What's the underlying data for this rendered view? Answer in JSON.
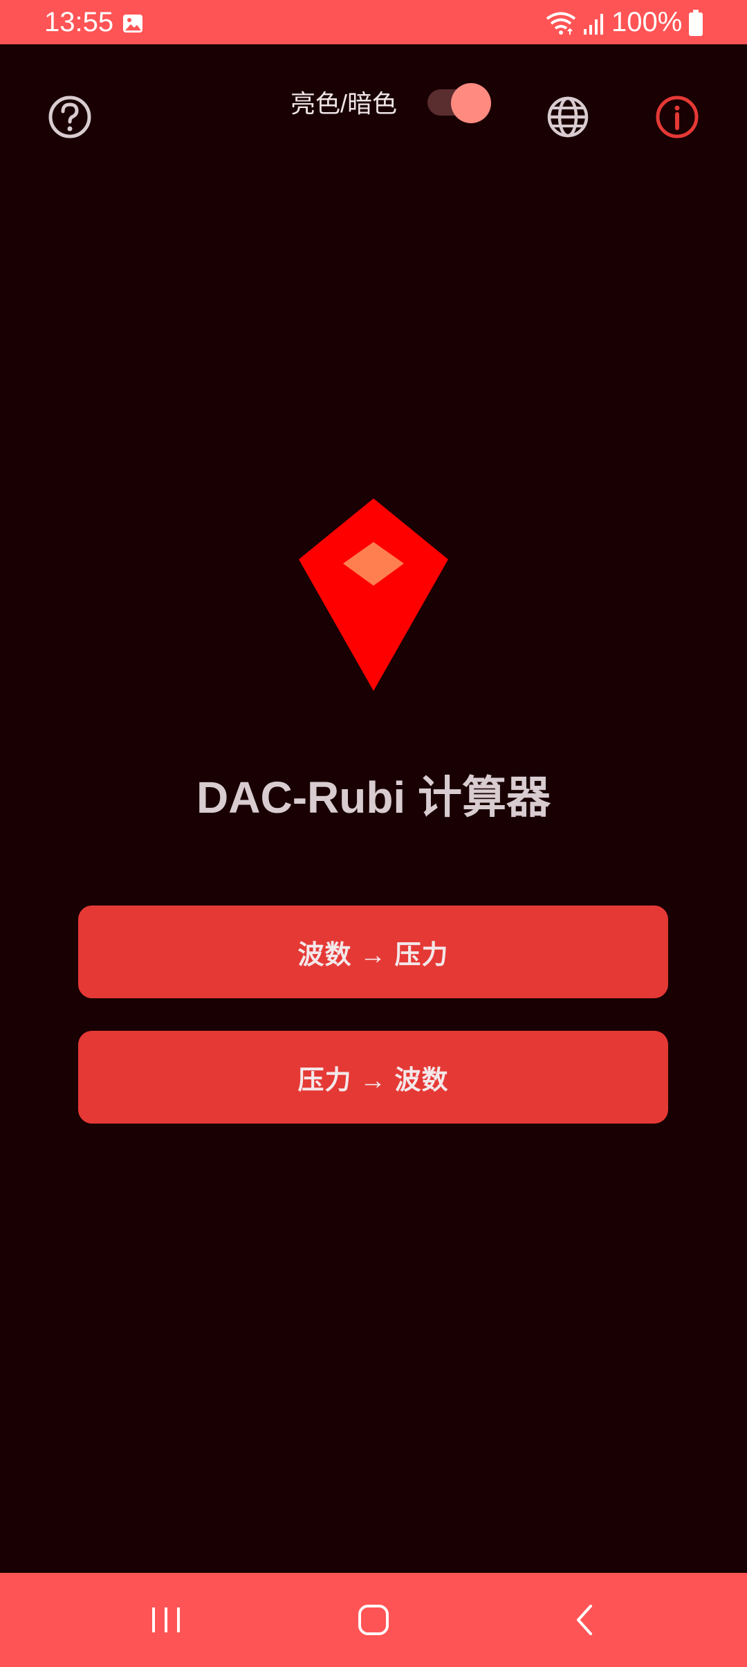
{
  "status_bar": {
    "time": "13:55",
    "battery": "100%",
    "icons": [
      "photo-icon",
      "wifi-icon",
      "signal-icon",
      "battery-icon"
    ]
  },
  "toolbar": {
    "theme_label": "亮色/暗色",
    "theme_toggle_on": true,
    "icons": [
      "help-icon",
      "globe-icon",
      "info-icon"
    ]
  },
  "main": {
    "title": "DAC-Rubi 计算器",
    "buttons": [
      {
        "label": "波数 → 压力"
      },
      {
        "label": "压力 → 波数"
      }
    ]
  },
  "nav_bar": {
    "icons": [
      "recents-icon",
      "home-icon",
      "back-icon"
    ]
  },
  "colors": {
    "accent": "#ff5455",
    "button": "#e53935",
    "background": "#190003",
    "logo_primary": "#ff0000",
    "logo_gem": "#ff7f50",
    "info_icon": "#e53935"
  }
}
